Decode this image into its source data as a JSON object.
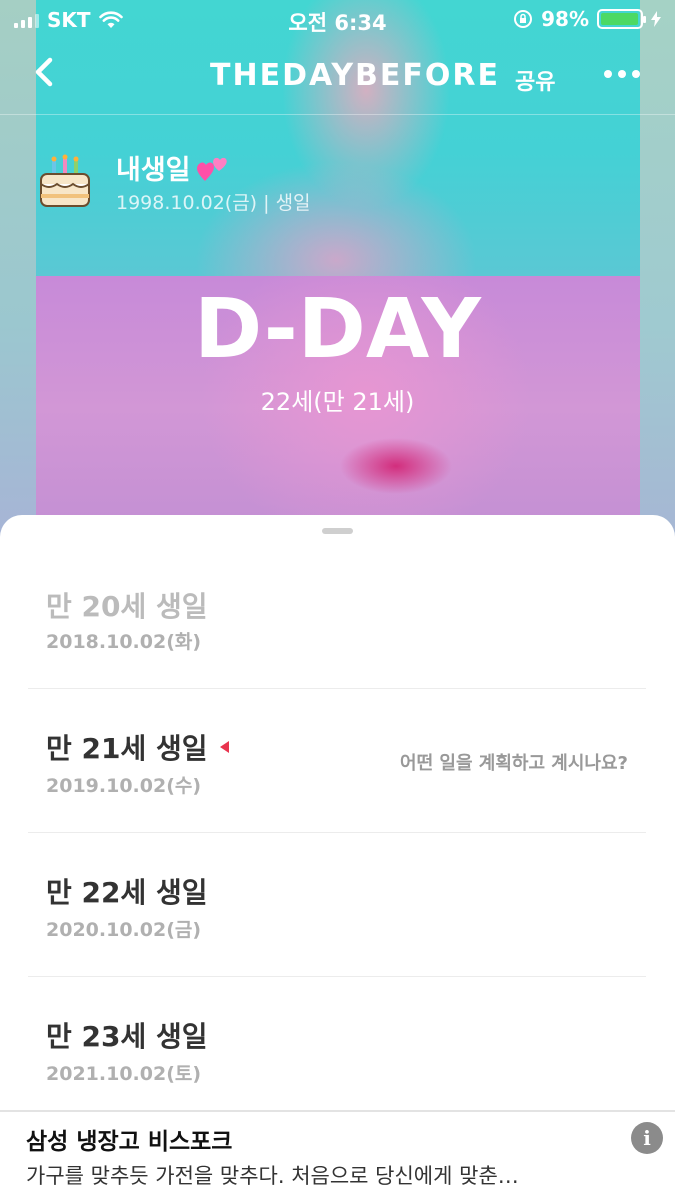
{
  "status_bar": {
    "carrier": "SKT",
    "time": "오전 6:34",
    "battery": "98%",
    "battery_level": 0.98
  },
  "nav": {
    "logo": "THEDAYBEFORE",
    "share_label": "공유",
    "icons": [
      "back-icon",
      "more-icon"
    ]
  },
  "event": {
    "title": "내생일",
    "subtitle": "1998.10.02(금)  |  생일",
    "icons": [
      "cake-icon",
      "heart-icon"
    ]
  },
  "dday": {
    "label": "D-DAY",
    "age": "22세(만 21세)"
  },
  "list": [
    {
      "title": "만 20세 생일",
      "date": "2018.10.02(화)",
      "state": "past"
    },
    {
      "title": "만 21세 생일",
      "date": "2019.10.02(수)",
      "state": "current",
      "hint": "어떤 일을 계획하고 계시나요?"
    },
    {
      "title": "만 22세 생일",
      "date": "2020.10.02(금)",
      "state": "future"
    },
    {
      "title": "만 23세 생일",
      "date": "2021.10.02(토)",
      "state": "future"
    }
  ],
  "ad": {
    "title": "삼성 냉장고 비스포크",
    "description": "가구를 맞추듯 가전을 맞추다. 처음으로 당신에게 맞춘…",
    "info_symbol": "i"
  },
  "colors": {
    "accent_marker": "#e8344e",
    "battery_green": "#4cd964"
  }
}
